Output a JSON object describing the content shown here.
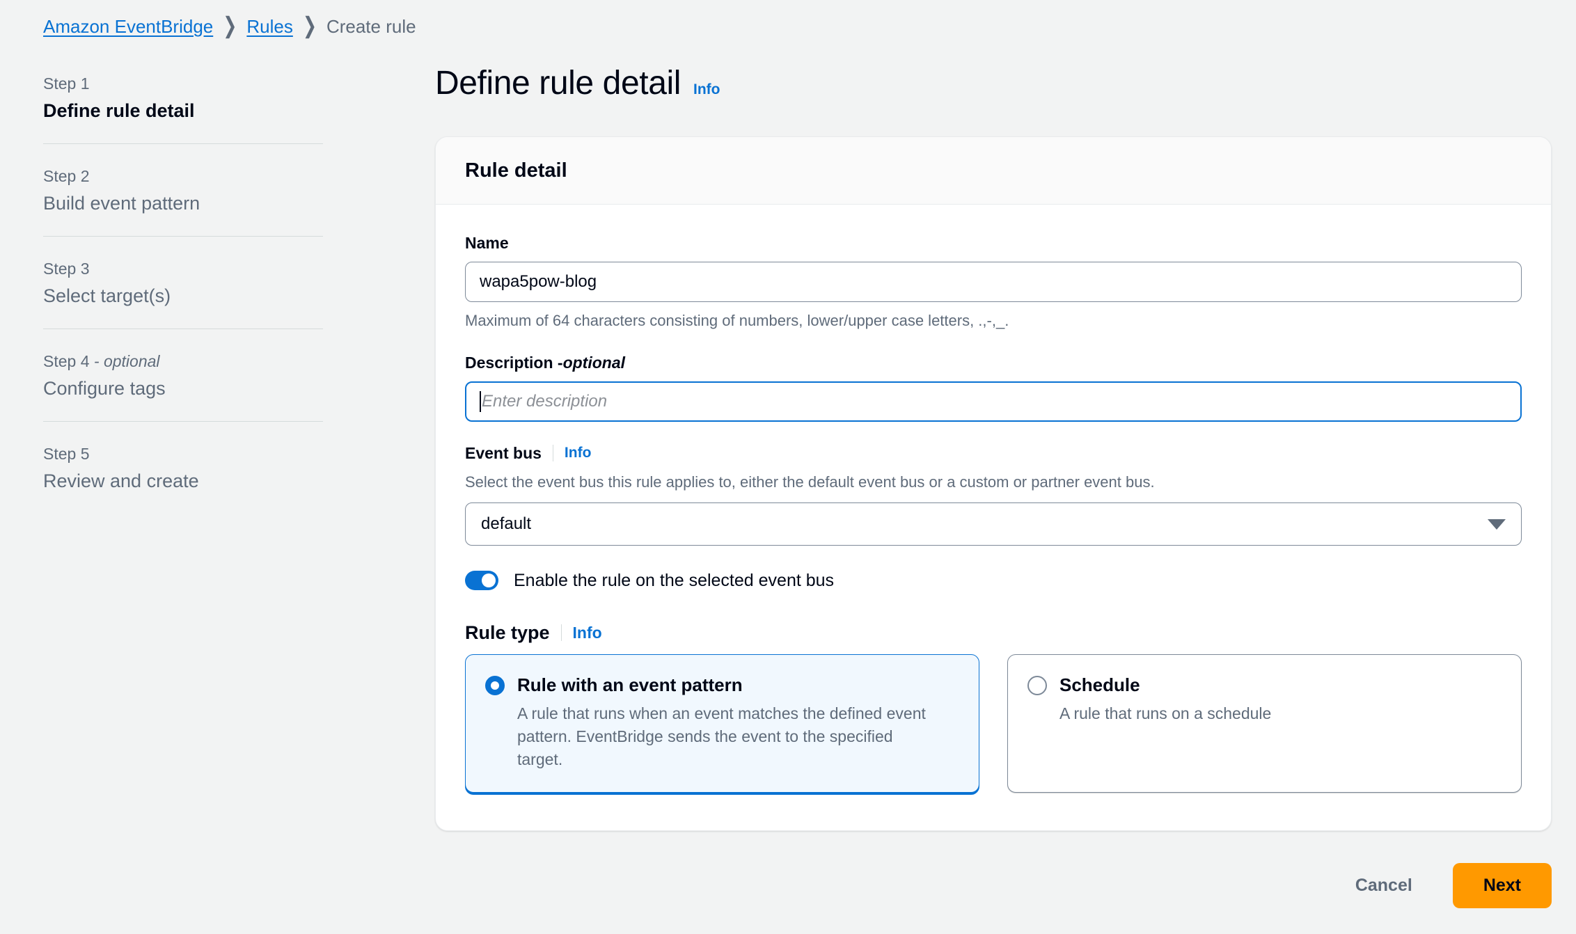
{
  "breadcrumb": {
    "items": [
      {
        "label": "Amazon EventBridge",
        "type": "link"
      },
      {
        "label": "Rules",
        "type": "link"
      },
      {
        "label": "Create rule",
        "type": "current"
      }
    ],
    "separator": "❯"
  },
  "steps": [
    {
      "num": "Step 1",
      "title": "Define rule detail",
      "optional": "",
      "active": true
    },
    {
      "num": "Step 2",
      "title": "Build event pattern",
      "optional": "",
      "active": false
    },
    {
      "num": "Step 3",
      "title": "Select target(s)",
      "optional": "",
      "active": false
    },
    {
      "num": "Step 4",
      "title": "Configure tags",
      "optional": " - optional",
      "active": false
    },
    {
      "num": "Step 5",
      "title": "Review and create",
      "optional": "",
      "active": false
    }
  ],
  "page": {
    "title": "Define rule detail",
    "info_label": "Info"
  },
  "panel": {
    "header": "Rule detail"
  },
  "form": {
    "name": {
      "label": "Name",
      "value": "wapa5pow-blog",
      "constraint": "Maximum of 64 characters consisting of numbers, lower/upper case letters, .,-,_."
    },
    "description": {
      "label": "Description - ",
      "label_optional": "optional",
      "placeholder": "Enter description",
      "value": ""
    },
    "event_bus": {
      "label": "Event bus",
      "info_label": "Info",
      "description": "Select the event bus this rule applies to, either the default event bus or a custom or partner event bus.",
      "selected": "default",
      "options": [
        "default"
      ]
    },
    "enable_toggle": {
      "label": "Enable the rule on the selected event bus",
      "checked": true
    },
    "rule_type": {
      "label": "Rule type",
      "info_label": "Info",
      "options": [
        {
          "title": "Rule with an event pattern",
          "description": "A rule that runs when an event matches the defined event pattern. EventBridge sends the event to the specified target.",
          "selected": true
        },
        {
          "title": "Schedule",
          "description": "A rule that runs on a schedule",
          "selected": false
        }
      ]
    }
  },
  "actions": {
    "cancel_label": "Cancel",
    "next_label": "Next"
  },
  "colors": {
    "link_blue": "#0972d3",
    "accent_orange": "#ff9900",
    "page_bg": "#f2f3f3",
    "text_primary": "#000716",
    "text_secondary": "#5f6b7a"
  }
}
